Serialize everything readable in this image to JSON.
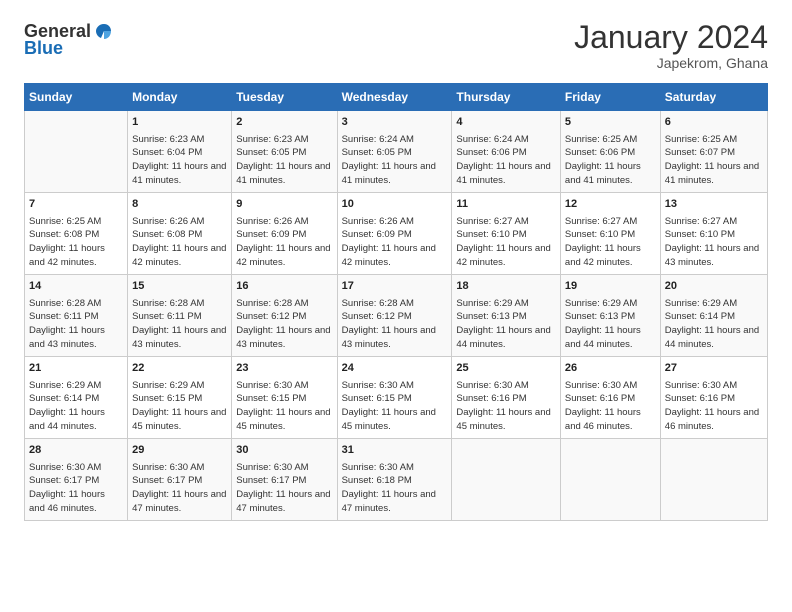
{
  "logo": {
    "general": "General",
    "blue": "Blue"
  },
  "title": "January 2024",
  "subtitle": "Japekrom, Ghana",
  "days_header": [
    "Sunday",
    "Monday",
    "Tuesday",
    "Wednesday",
    "Thursday",
    "Friday",
    "Saturday"
  ],
  "weeks": [
    [
      {
        "day": "",
        "sunrise": "",
        "sunset": "",
        "daylight": ""
      },
      {
        "day": "1",
        "sunrise": "Sunrise: 6:23 AM",
        "sunset": "Sunset: 6:04 PM",
        "daylight": "Daylight: 11 hours and 41 minutes."
      },
      {
        "day": "2",
        "sunrise": "Sunrise: 6:23 AM",
        "sunset": "Sunset: 6:05 PM",
        "daylight": "Daylight: 11 hours and 41 minutes."
      },
      {
        "day": "3",
        "sunrise": "Sunrise: 6:24 AM",
        "sunset": "Sunset: 6:05 PM",
        "daylight": "Daylight: 11 hours and 41 minutes."
      },
      {
        "day": "4",
        "sunrise": "Sunrise: 6:24 AM",
        "sunset": "Sunset: 6:06 PM",
        "daylight": "Daylight: 11 hours and 41 minutes."
      },
      {
        "day": "5",
        "sunrise": "Sunrise: 6:25 AM",
        "sunset": "Sunset: 6:06 PM",
        "daylight": "Daylight: 11 hours and 41 minutes."
      },
      {
        "day": "6",
        "sunrise": "Sunrise: 6:25 AM",
        "sunset": "Sunset: 6:07 PM",
        "daylight": "Daylight: 11 hours and 41 minutes."
      }
    ],
    [
      {
        "day": "7",
        "sunrise": "Sunrise: 6:25 AM",
        "sunset": "Sunset: 6:08 PM",
        "daylight": "Daylight: 11 hours and 42 minutes."
      },
      {
        "day": "8",
        "sunrise": "Sunrise: 6:26 AM",
        "sunset": "Sunset: 6:08 PM",
        "daylight": "Daylight: 11 hours and 42 minutes."
      },
      {
        "day": "9",
        "sunrise": "Sunrise: 6:26 AM",
        "sunset": "Sunset: 6:09 PM",
        "daylight": "Daylight: 11 hours and 42 minutes."
      },
      {
        "day": "10",
        "sunrise": "Sunrise: 6:26 AM",
        "sunset": "Sunset: 6:09 PM",
        "daylight": "Daylight: 11 hours and 42 minutes."
      },
      {
        "day": "11",
        "sunrise": "Sunrise: 6:27 AM",
        "sunset": "Sunset: 6:10 PM",
        "daylight": "Daylight: 11 hours and 42 minutes."
      },
      {
        "day": "12",
        "sunrise": "Sunrise: 6:27 AM",
        "sunset": "Sunset: 6:10 PM",
        "daylight": "Daylight: 11 hours and 42 minutes."
      },
      {
        "day": "13",
        "sunrise": "Sunrise: 6:27 AM",
        "sunset": "Sunset: 6:10 PM",
        "daylight": "Daylight: 11 hours and 43 minutes."
      }
    ],
    [
      {
        "day": "14",
        "sunrise": "Sunrise: 6:28 AM",
        "sunset": "Sunset: 6:11 PM",
        "daylight": "Daylight: 11 hours and 43 minutes."
      },
      {
        "day": "15",
        "sunrise": "Sunrise: 6:28 AM",
        "sunset": "Sunset: 6:11 PM",
        "daylight": "Daylight: 11 hours and 43 minutes."
      },
      {
        "day": "16",
        "sunrise": "Sunrise: 6:28 AM",
        "sunset": "Sunset: 6:12 PM",
        "daylight": "Daylight: 11 hours and 43 minutes."
      },
      {
        "day": "17",
        "sunrise": "Sunrise: 6:28 AM",
        "sunset": "Sunset: 6:12 PM",
        "daylight": "Daylight: 11 hours and 43 minutes."
      },
      {
        "day": "18",
        "sunrise": "Sunrise: 6:29 AM",
        "sunset": "Sunset: 6:13 PM",
        "daylight": "Daylight: 11 hours and 44 minutes."
      },
      {
        "day": "19",
        "sunrise": "Sunrise: 6:29 AM",
        "sunset": "Sunset: 6:13 PM",
        "daylight": "Daylight: 11 hours and 44 minutes."
      },
      {
        "day": "20",
        "sunrise": "Sunrise: 6:29 AM",
        "sunset": "Sunset: 6:14 PM",
        "daylight": "Daylight: 11 hours and 44 minutes."
      }
    ],
    [
      {
        "day": "21",
        "sunrise": "Sunrise: 6:29 AM",
        "sunset": "Sunset: 6:14 PM",
        "daylight": "Daylight: 11 hours and 44 minutes."
      },
      {
        "day": "22",
        "sunrise": "Sunrise: 6:29 AM",
        "sunset": "Sunset: 6:15 PM",
        "daylight": "Daylight: 11 hours and 45 minutes."
      },
      {
        "day": "23",
        "sunrise": "Sunrise: 6:30 AM",
        "sunset": "Sunset: 6:15 PM",
        "daylight": "Daylight: 11 hours and 45 minutes."
      },
      {
        "day": "24",
        "sunrise": "Sunrise: 6:30 AM",
        "sunset": "Sunset: 6:15 PM",
        "daylight": "Daylight: 11 hours and 45 minutes."
      },
      {
        "day": "25",
        "sunrise": "Sunrise: 6:30 AM",
        "sunset": "Sunset: 6:16 PM",
        "daylight": "Daylight: 11 hours and 45 minutes."
      },
      {
        "day": "26",
        "sunrise": "Sunrise: 6:30 AM",
        "sunset": "Sunset: 6:16 PM",
        "daylight": "Daylight: 11 hours and 46 minutes."
      },
      {
        "day": "27",
        "sunrise": "Sunrise: 6:30 AM",
        "sunset": "Sunset: 6:16 PM",
        "daylight": "Daylight: 11 hours and 46 minutes."
      }
    ],
    [
      {
        "day": "28",
        "sunrise": "Sunrise: 6:30 AM",
        "sunset": "Sunset: 6:17 PM",
        "daylight": "Daylight: 11 hours and 46 minutes."
      },
      {
        "day": "29",
        "sunrise": "Sunrise: 6:30 AM",
        "sunset": "Sunset: 6:17 PM",
        "daylight": "Daylight: 11 hours and 47 minutes."
      },
      {
        "day": "30",
        "sunrise": "Sunrise: 6:30 AM",
        "sunset": "Sunset: 6:17 PM",
        "daylight": "Daylight: 11 hours and 47 minutes."
      },
      {
        "day": "31",
        "sunrise": "Sunrise: 6:30 AM",
        "sunset": "Sunset: 6:18 PM",
        "daylight": "Daylight: 11 hours and 47 minutes."
      },
      {
        "day": "",
        "sunrise": "",
        "sunset": "",
        "daylight": ""
      },
      {
        "day": "",
        "sunrise": "",
        "sunset": "",
        "daylight": ""
      },
      {
        "day": "",
        "sunrise": "",
        "sunset": "",
        "daylight": ""
      }
    ]
  ]
}
